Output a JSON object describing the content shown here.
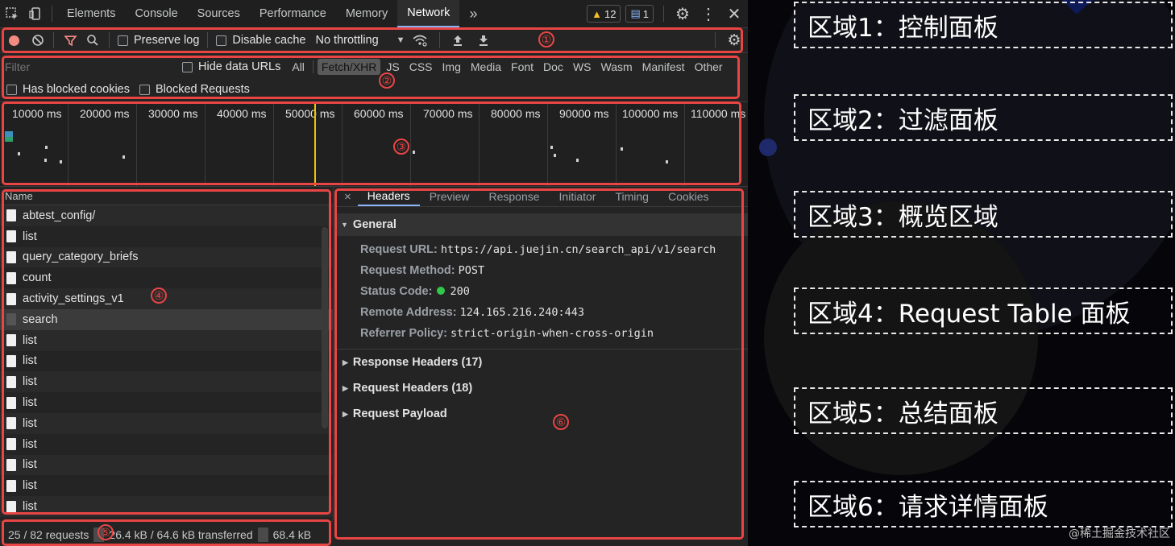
{
  "tabbar": {
    "tabs": [
      "Elements",
      "Console",
      "Sources",
      "Performance",
      "Memory",
      "Network"
    ],
    "more": "»",
    "warnings": "12",
    "messages": "1"
  },
  "controls": {
    "preserve_log": "Preserve log",
    "disable_cache": "Disable cache",
    "throttling": "No throttling"
  },
  "filter": {
    "placeholder": "Filter",
    "hide_data_urls": "Hide data URLs",
    "types": [
      "All",
      "Fetch/XHR",
      "JS",
      "CSS",
      "Img",
      "Media",
      "Font",
      "Doc",
      "WS",
      "Wasm",
      "Manifest",
      "Other"
    ],
    "active_type": "Fetch/XHR",
    "has_blocked_cookies": "Has blocked cookies",
    "blocked_requests": "Blocked Requests"
  },
  "overview": {
    "ticks": [
      "10000 ms",
      "20000 ms",
      "30000 ms",
      "40000 ms",
      "50000 ms",
      "60000 ms",
      "70000 ms",
      "80000 ms",
      "90000 ms",
      "100000 ms",
      "110000 ms"
    ]
  },
  "request_table": {
    "header": "Name",
    "rows": [
      "abtest_config/",
      "list",
      "query_category_briefs",
      "count",
      "activity_settings_v1",
      "search",
      "list",
      "list",
      "list",
      "list",
      "list",
      "list",
      "list",
      "list",
      "list"
    ],
    "selected": "search"
  },
  "summary": {
    "requests": "25 / 82 requests",
    "transferred": "26.4 kB / 64.6 kB transferred",
    "resources": "68.4 kB"
  },
  "details": {
    "close": "×",
    "tabs": [
      "Headers",
      "Preview",
      "Response",
      "Initiator",
      "Timing",
      "Cookies"
    ],
    "general_title": "General",
    "request_url_key": "Request URL:",
    "request_url_val": "https://api.juejin.cn/search_api/v1/search",
    "request_method_key": "Request Method:",
    "request_method_val": "POST",
    "status_code_key": "Status Code:",
    "status_code_val": "200",
    "remote_address_key": "Remote Address:",
    "remote_address_val": "124.165.216.240:443",
    "referrer_policy_key": "Referrer Policy:",
    "referrer_policy_val": "strict-origin-when-cross-origin",
    "response_headers": "Response Headers (17)",
    "request_headers": "Request Headers (18)",
    "request_payload": "Request Payload"
  },
  "annotations": [
    "①",
    "②",
    "③",
    "④",
    "⑤",
    "⑥"
  ],
  "legend": [
    "区域1：控制面板",
    "区域2：过滤面板",
    "区域3：概览区域",
    "区域4：Request Table 面板",
    "区域5：总结面板",
    "区域6：请求详情面板"
  ],
  "watermark": "@稀土掘金技术社区",
  "colors": {
    "annotation_red": "#e84545",
    "status_green": "#2fc84a",
    "timeline_yellow": "#f2c300"
  }
}
